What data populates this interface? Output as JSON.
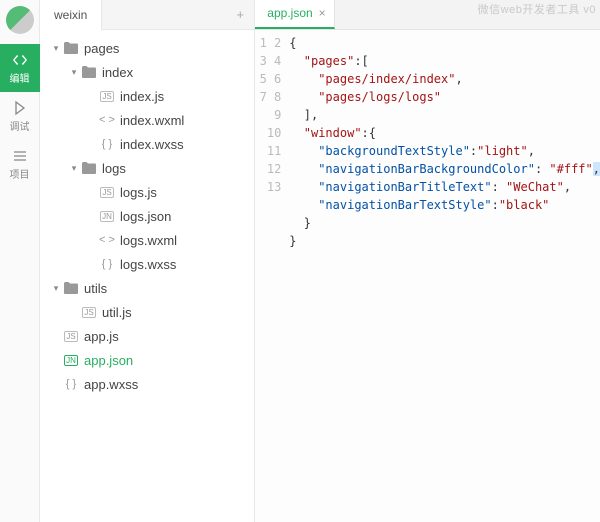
{
  "titleRemnant": "微信web开发者工具 v0",
  "rail": {
    "items": [
      {
        "label": "编辑"
      },
      {
        "label": "调试"
      },
      {
        "label": "项目"
      }
    ]
  },
  "sidebar": {
    "tab": "weixin",
    "treeRows": [
      {
        "depth": 0,
        "kind": "folder",
        "caret": "▾",
        "label": "pages"
      },
      {
        "depth": 1,
        "kind": "folder",
        "caret": "▾",
        "label": "index"
      },
      {
        "depth": 2,
        "kind": "js",
        "label": "index.js"
      },
      {
        "depth": 2,
        "kind": "wxml",
        "label": "index.wxml"
      },
      {
        "depth": 2,
        "kind": "wxss",
        "label": "index.wxss"
      },
      {
        "depth": 1,
        "kind": "folder",
        "caret": "▾",
        "label": "logs"
      },
      {
        "depth": 2,
        "kind": "js",
        "label": "logs.js"
      },
      {
        "depth": 2,
        "kind": "json",
        "label": "logs.json"
      },
      {
        "depth": 2,
        "kind": "wxml",
        "label": "logs.wxml"
      },
      {
        "depth": 2,
        "kind": "wxss",
        "label": "logs.wxss"
      },
      {
        "depth": 0,
        "kind": "folder",
        "caret": "▾",
        "label": "utils"
      },
      {
        "depth": 1,
        "kind": "js",
        "label": "util.js"
      },
      {
        "depth": 0,
        "kind": "js",
        "label": "app.js"
      },
      {
        "depth": 0,
        "kind": "json",
        "label": "app.json",
        "active": true
      },
      {
        "depth": 0,
        "kind": "wxss",
        "label": "app.wxss"
      }
    ]
  },
  "editor": {
    "tab": "app.json",
    "lines": [
      [
        [
          "p",
          "{"
        ]
      ],
      [
        [
          "p",
          "  "
        ],
        [
          "k",
          "\"pages\""
        ],
        [
          "p",
          ":["
        ]
      ],
      [
        [
          "p",
          "    "
        ],
        [
          "k",
          "\"pages/index/index\""
        ],
        [
          "p",
          ","
        ]
      ],
      [
        [
          "p",
          "    "
        ],
        [
          "k",
          "\"pages/logs/logs\""
        ]
      ],
      [
        [
          "p",
          "  ],"
        ]
      ],
      [
        [
          "p",
          "  "
        ],
        [
          "k",
          "\"window\""
        ],
        [
          "p",
          ":{"
        ]
      ],
      [
        [
          "p",
          "    "
        ],
        [
          "k2",
          "\"backgroundTextStyle\""
        ],
        [
          "p",
          ":"
        ],
        [
          "k",
          "\"light\""
        ],
        [
          "p",
          ","
        ]
      ],
      [
        [
          "p",
          "    "
        ],
        [
          "k2",
          "\"navigationBarBackgroundColor\""
        ],
        [
          "p",
          ": "
        ],
        [
          "k",
          "\"#fff\""
        ],
        [
          "selp",
          ","
        ]
      ],
      [
        [
          "p",
          "    "
        ],
        [
          "k2",
          "\"navigationBarTitleText\""
        ],
        [
          "p",
          ": "
        ],
        [
          "k",
          "\"WeChat\""
        ],
        [
          "p",
          ","
        ]
      ],
      [
        [
          "p",
          "    "
        ],
        [
          "k2",
          "\"navigationBarTextStyle\""
        ],
        [
          "p",
          ":"
        ],
        [
          "k",
          "\"black\""
        ]
      ],
      [
        [
          "p",
          "  }"
        ]
      ],
      [
        [
          "p",
          "}"
        ]
      ],
      [
        [
          "p",
          ""
        ]
      ]
    ]
  }
}
